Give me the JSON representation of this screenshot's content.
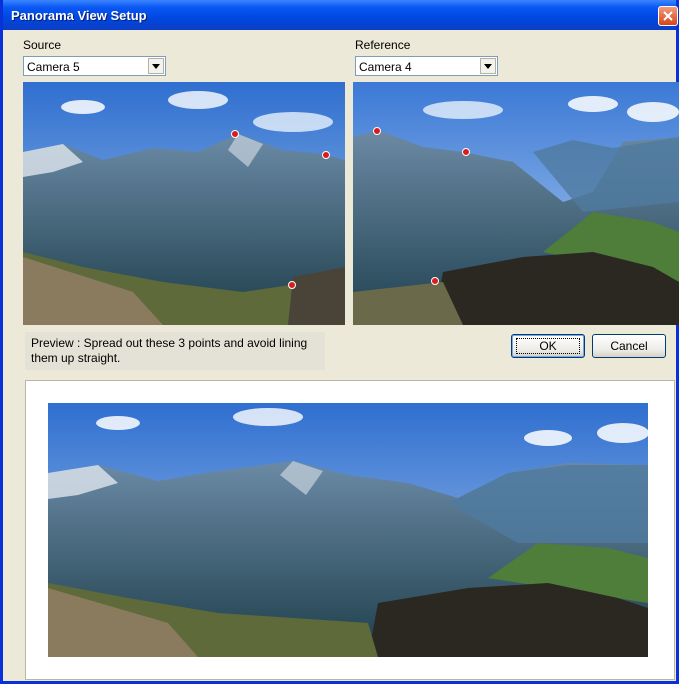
{
  "window": {
    "title": "Panorama View Setup"
  },
  "source": {
    "label": "Source",
    "selected": "Camera 5"
  },
  "reference": {
    "label": "Reference",
    "selected": "Camera 4"
  },
  "preview": {
    "hint": "Preview : Spread out these 3 points and avoid lining them up straight."
  },
  "buttons": {
    "ok": "OK",
    "cancel": "Cancel"
  },
  "icons": {
    "close": "close-icon",
    "dropdown": "chevron-down-icon"
  },
  "colors": {
    "titlebar": "#0a57f4",
    "dialog": "#ece9d8",
    "close": "#d8431c",
    "marker": "#d91d1d"
  }
}
